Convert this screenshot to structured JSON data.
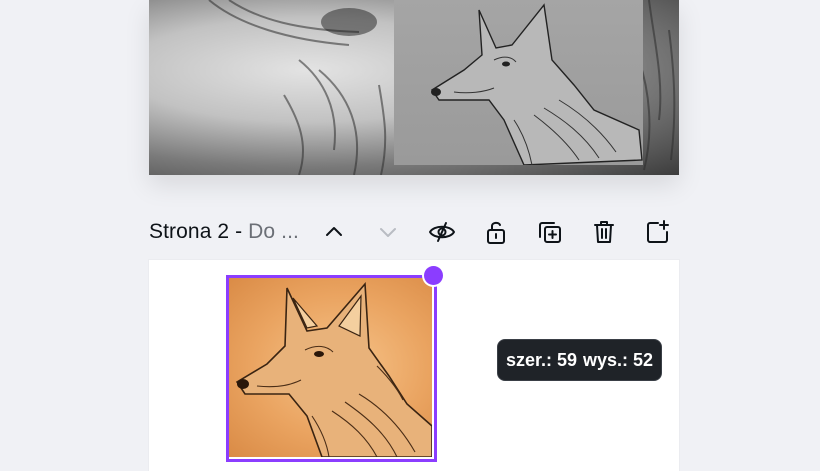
{
  "page2": {
    "title": "Strona 2 - ",
    "subtitle": "Do ...",
    "toolbar": {
      "move_up": "chevron-up-icon",
      "move_down": "chevron-down-icon",
      "hide": "eye-slash-icon",
      "lock": "unlock-icon",
      "duplicate": "duplicate-icon",
      "delete": "trash-icon",
      "add_page": "add-page-icon"
    }
  },
  "selection": {
    "accent_color": "#8b3dff"
  },
  "size_tooltip": {
    "width_text": "szer.: 59",
    "height_text": "wys.: 52"
  }
}
